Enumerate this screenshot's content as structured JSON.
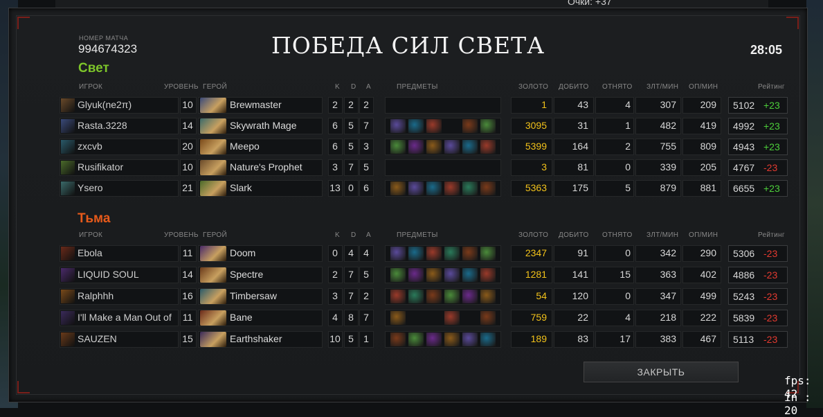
{
  "top_score": "Очки: +37",
  "match": {
    "label": "НОМЕР МАТЧА",
    "id": "994674323",
    "result_title": "ПОБЕДА СИЛ СВЕТА",
    "duration": "28:05"
  },
  "headers": {
    "player": "ИГРОК",
    "level": "УРОВЕНЬ",
    "hero": "ГЕРОЙ",
    "k": "K",
    "d": "D",
    "a": "A",
    "items": "ПРЕДМЕТЫ",
    "gold": "ЗОЛОТО",
    "last_hits": "ДОБИТО",
    "denies": "ОТНЯТО",
    "gpm": "ЗЛТ/МИН",
    "xpm": "ОП/МИН",
    "rating": "Рейтинг"
  },
  "radiant": {
    "name": "Свет",
    "players": [
      {
        "player": "Glyuk(ne2π)",
        "level": "10",
        "hero": "Brewmaster",
        "k": "2",
        "d": "2",
        "a": "2",
        "gold": "1",
        "lh": "43",
        "dn": "4",
        "gpm": "307",
        "xpm": "209",
        "mmr": "5102",
        "delta": "+23",
        "items": []
      },
      {
        "player": "Rasta.3228",
        "level": "14",
        "hero": "Skywrath Mage",
        "k": "6",
        "d": "5",
        "a": "7",
        "gold": "3095",
        "lh": "31",
        "dn": "1",
        "gpm": "482",
        "xpm": "419",
        "mmr": "4992",
        "delta": "+23",
        "items": [
          "item-1",
          "item-2",
          "item-3",
          "",
          "item-5",
          "item-6"
        ]
      },
      {
        "player": "zxcvb",
        "level": "20",
        "hero": "Meepo",
        "k": "6",
        "d": "5",
        "a": "3",
        "gold": "5399",
        "lh": "164",
        "dn": "2",
        "gpm": "755",
        "xpm": "809",
        "mmr": "4943",
        "delta": "+23",
        "items": [
          "item-1",
          "item-2",
          "item-3",
          "item-4",
          "item-5",
          "item-6"
        ]
      },
      {
        "player": "Rusifikator",
        "level": "10",
        "hero": "Nature's Prophet",
        "k": "3",
        "d": "7",
        "a": "5",
        "gold": "3",
        "lh": "81",
        "dn": "0",
        "gpm": "339",
        "xpm": "205",
        "mmr": "4767",
        "delta": "-23",
        "items": []
      },
      {
        "player": "Ysero",
        "level": "21",
        "hero": "Slark",
        "k": "13",
        "d": "0",
        "a": "6",
        "gold": "5363",
        "lh": "175",
        "dn": "5",
        "gpm": "879",
        "xpm": "881",
        "mmr": "6655",
        "delta": "+23",
        "items": [
          "item-1",
          "item-2",
          "item-3",
          "item-4",
          "item-5",
          "item-6"
        ]
      }
    ]
  },
  "dire": {
    "name": "Тьма",
    "players": [
      {
        "player": "Ebola",
        "level": "11",
        "hero": "Doom",
        "k": "0",
        "d": "4",
        "a": "4",
        "gold": "2347",
        "lh": "91",
        "dn": "0",
        "gpm": "342",
        "xpm": "290",
        "mmr": "5306",
        "delta": "-23",
        "items": [
          "item-1",
          "item-2",
          "item-3",
          "item-4",
          "item-5",
          "item-6"
        ]
      },
      {
        "player": "LIQUID SOUL",
        "level": "14",
        "hero": "Spectre",
        "k": "2",
        "d": "7",
        "a": "5",
        "gold": "1281",
        "lh": "141",
        "dn": "15",
        "gpm": "363",
        "xpm": "402",
        "mmr": "4886",
        "delta": "-23",
        "items": [
          "item-1",
          "item-2",
          "item-3",
          "item-4",
          "item-5",
          "item-6"
        ]
      },
      {
        "player": "Ralphhh",
        "level": "16",
        "hero": "Timbersaw",
        "k": "3",
        "d": "7",
        "a": "2",
        "gold": "54",
        "lh": "120",
        "dn": "0",
        "gpm": "347",
        "xpm": "499",
        "mmr": "5243",
        "delta": "-23",
        "items": [
          "item-1",
          "item-2",
          "item-3",
          "item-4",
          "item-5",
          "item-6"
        ]
      },
      {
        "player": "I'll Make a Man Out of",
        "level": "11",
        "hero": "Bane",
        "k": "4",
        "d": "8",
        "a": "7",
        "gold": "759",
        "lh": "22",
        "dn": "4",
        "gpm": "218",
        "xpm": "222",
        "mmr": "5839",
        "delta": "-23",
        "items": [
          "item-1",
          "",
          "",
          "item-4",
          "",
          "item-6"
        ]
      },
      {
        "player": "SAUZEN",
        "level": "15",
        "hero": "Earthshaker",
        "k": "10",
        "d": "5",
        "a": "1",
        "gold": "189",
        "lh": "83",
        "dn": "17",
        "gpm": "383",
        "xpm": "467",
        "mmr": "5113",
        "delta": "-23",
        "items": [
          "item-1",
          "item-2",
          "item-3",
          "item-4",
          "item-5",
          "item-6"
        ]
      }
    ]
  },
  "close_button": "ЗАКРЫТЬ",
  "overlay": {
    "fps": "fps: 42",
    "in": "in : 20"
  },
  "colors": {
    "radiant": "#7dc52a",
    "dire": "#e85a1a",
    "gold": "#f2c21a",
    "positive": "#4ccf3a",
    "negative": "#e33a30"
  }
}
